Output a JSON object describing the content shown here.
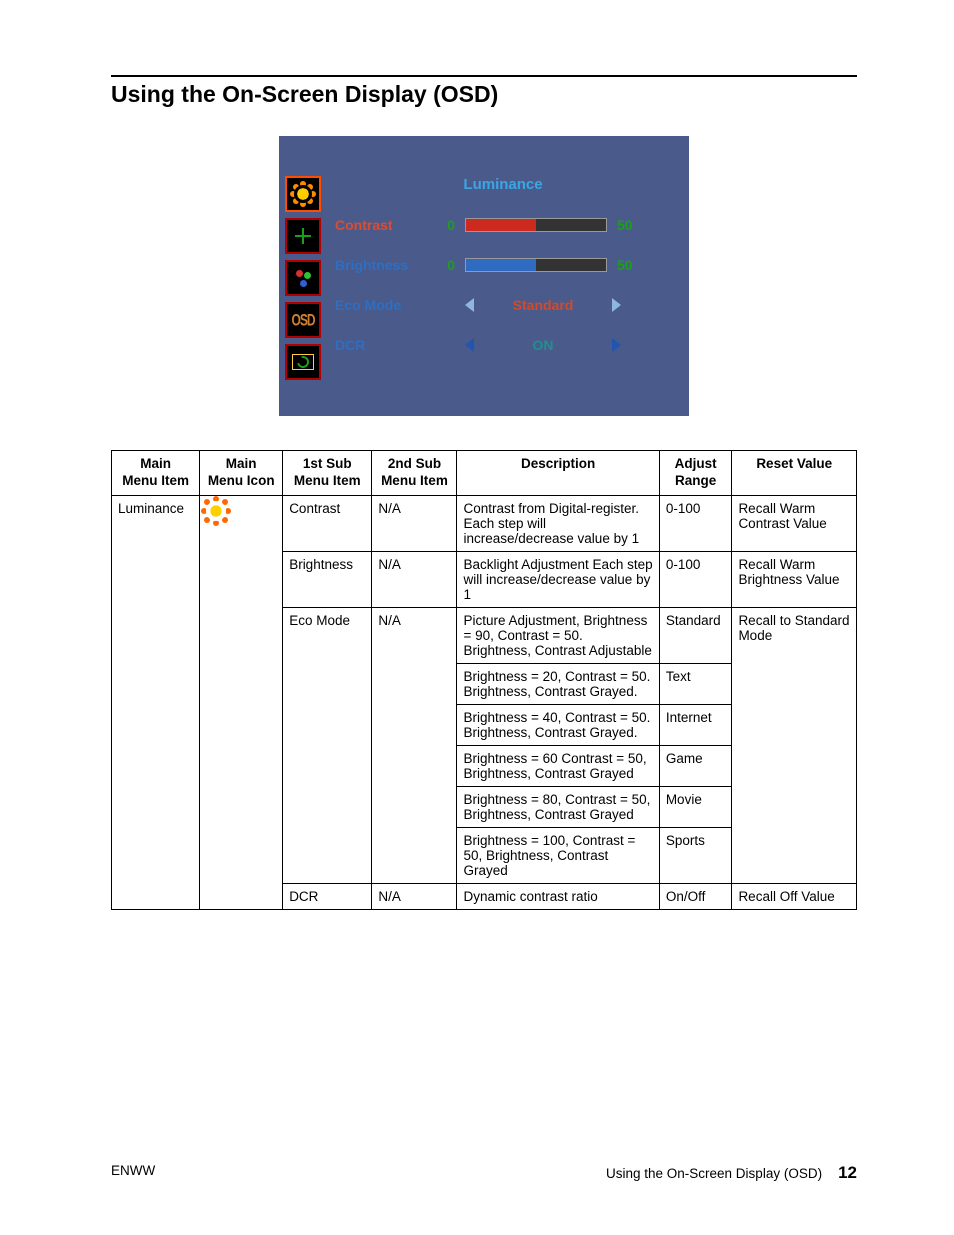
{
  "heading": "Using the On-Screen Display (OSD)",
  "osd": {
    "title": "Luminance",
    "tabs": [
      {
        "name": "luminance-icon",
        "active": true
      },
      {
        "name": "image-setup-icon",
        "active": false
      },
      {
        "name": "color-temp-icon",
        "active": false
      },
      {
        "name": "osd-setup-icon",
        "active": false
      },
      {
        "name": "extra-icon",
        "active": false
      }
    ],
    "rows": {
      "contrast": {
        "label": "Contrast",
        "min": "0",
        "value": "50",
        "fill_pct": 50
      },
      "brightness": {
        "label": "Brightness",
        "min": "0",
        "value": "50",
        "fill_pct": 50
      },
      "eco": {
        "label": "Eco Mode",
        "value": "Standard"
      },
      "dcr": {
        "label": "DCR",
        "value": "ON"
      }
    }
  },
  "table": {
    "headers": {
      "c1": "Main\nMenu Item",
      "c2": "Main\nMenu Icon",
      "c3": "1st Sub\nMenu Item",
      "c4": "2nd Sub\nMenu Item",
      "c5": "Description",
      "c6": "Adjust\nRange",
      "c7": "Reset Value"
    },
    "main_item": "Luminance",
    "rows": [
      {
        "sub1": "Contrast",
        "sub2": "N/A",
        "desc": "Contrast from Digital-register. Each step will increase/decrease value by 1",
        "range": "0-100",
        "reset": "Recall Warm Contrast Value"
      },
      {
        "sub1": "Brightness",
        "sub2": "N/A",
        "desc": "Backlight Adjustment Each step will increase/decrease value by 1",
        "range": "0-100",
        "reset": "Recall Warm Brightness Value"
      },
      {
        "sub1": "Eco Mode",
        "sub2": "N/A",
        "desc": "Picture Adjustment, Brightness = 90, Contrast = 50. Brightness, Contrast Adjustable",
        "range": "Standard",
        "reset": "Recall to Standard Mode"
      },
      {
        "desc": "Brightness = 20, Contrast = 50. Brightness, Contrast Grayed.",
        "range": "Text"
      },
      {
        "desc": "Brightness = 40, Contrast = 50. Brightness, Contrast Grayed.",
        "range": "Internet"
      },
      {
        "desc": "Brightness = 60 Contrast = 50, Brightness, Contrast Grayed",
        "range": "Game"
      },
      {
        "desc": "Brightness = 80, Contrast = 50, Brightness, Contrast Grayed",
        "range": "Movie"
      },
      {
        "desc": "Brightness = 100, Contrast = 50, Brightness, Contrast Grayed",
        "range": "Sports"
      },
      {
        "sub1": "DCR",
        "sub2": "N/A",
        "desc": "Dynamic contrast ratio",
        "range": "On/Off",
        "reset": "Recall Off Value"
      }
    ]
  },
  "footer": {
    "left": "ENWW",
    "right_text": "Using the On-Screen Display (OSD)",
    "page": "12"
  }
}
